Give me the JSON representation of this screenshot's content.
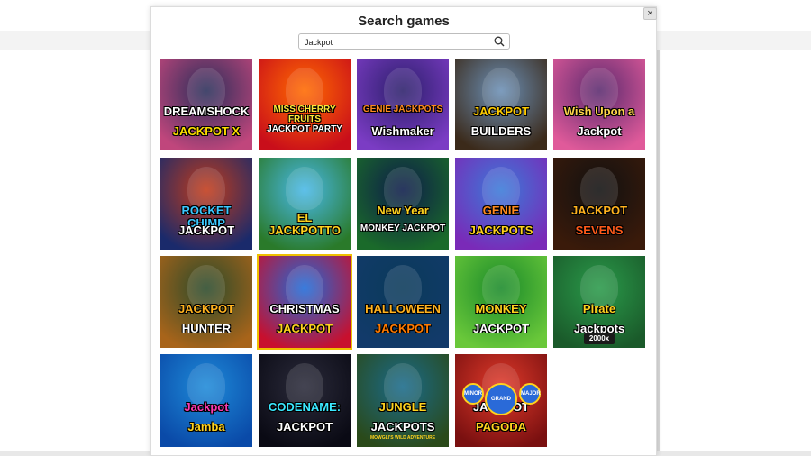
{
  "modal": {
    "title": "Search games",
    "close_label": "×"
  },
  "search": {
    "value": "Jackpot",
    "icon": "search-icon"
  },
  "games": [
    {
      "name": "DREAMSHOCK",
      "subtitle": "JACKPOT X",
      "bg1": "#2a2e5a",
      "bg2": "#c0467c",
      "fg": "#ffffff",
      "accent": "#ffde00"
    },
    {
      "name": "MISS CHERRY FRUITS",
      "subtitle": "JACKPOT PARTY",
      "bg1": "#ff6a00",
      "bg2": "#c90e1a",
      "fg": "#ffeb3b",
      "accent": "#ffffff"
    },
    {
      "name": "GENIE JACKPOTS",
      "subtitle": "Wishmaker",
      "bg1": "#2c1f6b",
      "bg2": "#7b3cc4",
      "fg": "#ff8a1e",
      "accent": "#ffffff"
    },
    {
      "name": "JACKPOT",
      "subtitle": "BUILDERS",
      "bg1": "#6b8fb5",
      "bg2": "#3b2a1a",
      "fg": "#ffcc00",
      "accent": "#ffffff"
    },
    {
      "name": "Wish Upon a",
      "subtitle": "Jackpot",
      "bg1": "#5a2a6e",
      "bg2": "#e05a9a",
      "fg": "#ffd54a",
      "accent": "#ffffff"
    },
    {
      "name": "ROCKET CHIMP",
      "subtitle": "JACKPOT",
      "bg1": "#c23b1a",
      "bg2": "#1a2a6b",
      "fg": "#3cc8ff",
      "accent": "#ffffff"
    },
    {
      "name": "EL JACKPOTTO",
      "subtitle": "",
      "bg1": "#48b8e8",
      "bg2": "#2a7a2a",
      "fg": "#ffd21e",
      "accent": "#7a2a00"
    },
    {
      "name": "New Year",
      "subtitle": "MONKEY JACKPOT",
      "bg1": "#0d1c4a",
      "bg2": "#1a6a2a",
      "fg": "#ffd21e",
      "accent": "#ffffff"
    },
    {
      "name": "GENIE",
      "subtitle": "JACKPOTS",
      "bg1": "#3a7ad8",
      "bg2": "#7a2ab8",
      "fg": "#ff8a1e",
      "accent": "#ffd21e"
    },
    {
      "name": "JACKPOT",
      "subtitle": "SEVENS",
      "bg1": "#111111",
      "bg2": "#3a1a0a",
      "fg": "#ffb21e",
      "accent": "#ff5a1a"
    },
    {
      "name": "JACKPOT",
      "subtitle": "HUNTER",
      "bg1": "#2a4a2a",
      "bg2": "#a8641a",
      "fg": "#ffb21e",
      "accent": "#ffffff"
    },
    {
      "name": "CHRISTMAS",
      "subtitle": "JACKPOT",
      "bg1": "#1e6ad8",
      "bg2": "#c8102e",
      "fg": "#ffffff",
      "accent": "#ffd21e"
    },
    {
      "name": "HALLOWEEN",
      "subtitle": "JACKPOT",
      "bg1": "#0a3a5a",
      "bg2": "#123a6a",
      "fg": "#ffb21e",
      "accent": "#ff7a00"
    },
    {
      "name": "MONKEY",
      "subtitle": "JACKPOT",
      "bg1": "#1a8a2a",
      "bg2": "#6ac83a",
      "fg": "#ffd21e",
      "accent": "#ffffff"
    },
    {
      "name": "Pirate",
      "subtitle": "Jackpots",
      "bg1": "#2a9a4a",
      "bg2": "#1a5a2a",
      "fg": "#ffd21e",
      "accent": "#ffffff"
    },
    {
      "name": "Jackpot",
      "subtitle": "Jamba",
      "bg1": "#1e8ad8",
      "bg2": "#0a4aa8",
      "fg": "#ff3ab0",
      "accent": "#ffd21e"
    },
    {
      "name": "CODENAME:",
      "subtitle": "JACKPOT",
      "bg1": "#2a2a3a",
      "bg2": "#0a0a14",
      "fg": "#3ae8ff",
      "accent": "#ffffff"
    },
    {
      "name": "JUNGLE",
      "subtitle": "JACKPOTS",
      "bg1": "#1a6a8a",
      "bg2": "#2a4a1a",
      "fg": "#ffd21e",
      "accent": "#ffffff"
    },
    {
      "name": "JACKPOT",
      "subtitle": "PAGODA",
      "bg1": "#e03a2a",
      "bg2": "#7a1010",
      "fg": "#ffffff",
      "accent": "#ffd21e"
    }
  ],
  "extra_text": {
    "pirate_badge": "2000x",
    "grand": "GRAND",
    "minor": "MINOR",
    "major": "MAJOR",
    "jungle_sub": "MOWGLI'S WILD ADVENTURE",
    "new_year": "New Year"
  }
}
